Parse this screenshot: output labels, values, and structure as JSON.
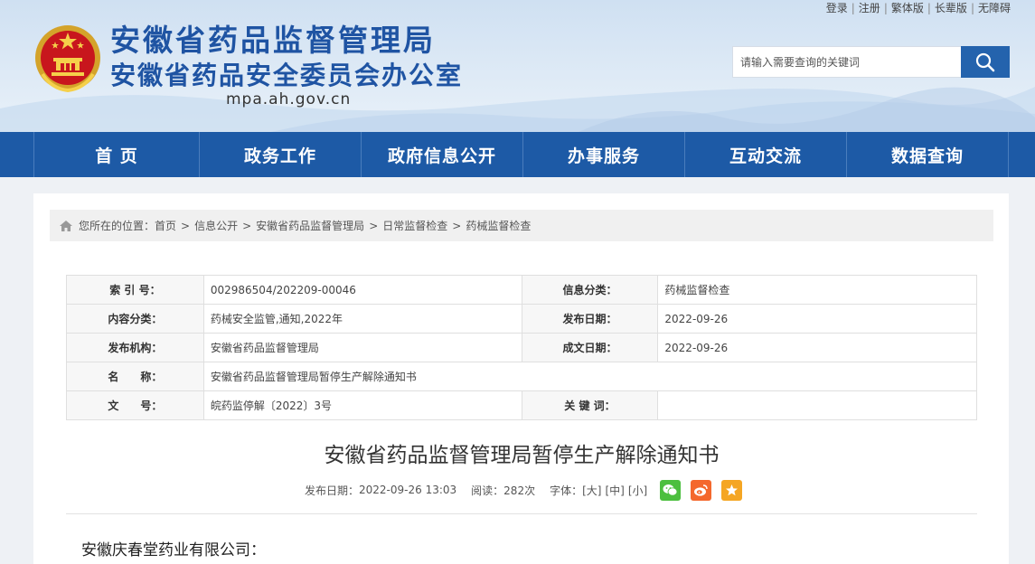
{
  "header": {
    "title_line1": "安徽省药品监督管理局",
    "title_line2": "安徽省药品安全委员会办公室",
    "domain": "mpa.ah.gov.cn",
    "top_links": [
      "登录",
      "注册",
      "繁体版",
      "长辈版",
      "无障碍"
    ],
    "search": {
      "placeholder": "请输入需要查询的关键词",
      "icon": "search-icon"
    }
  },
  "nav": {
    "items": [
      "首 页",
      "政务工作",
      "政府信息公开",
      "办事服务",
      "互动交流",
      "数据查询"
    ]
  },
  "breadcrumb": {
    "prefix": "您所在的位置：",
    "items": [
      "首页",
      "信息公开",
      "安徽省药品监督管理局",
      "日常监督检查",
      "药械监督检查"
    ],
    "separator": ">"
  },
  "meta_table": {
    "index_label": "索 引 号：",
    "index_value": "002986504/202209-00046",
    "category_label": "信息分类：",
    "category_value": "药械监督检查",
    "content_type_label": "内容分类：",
    "content_type_value": "药械安全监管,通知,2022年",
    "publish_date_label": "发布日期：",
    "publish_date_value": "2022-09-26",
    "publisher_label": "发布机构：",
    "publisher_value": "安徽省药品监督管理局",
    "created_date_label": "成文日期：",
    "created_date_value": "2022-09-26",
    "name_label": "名　　称：",
    "name_value": "安徽省药品监督管理局暂停生产解除通知书",
    "doc_no_label": "文　　号：",
    "doc_no_value": "皖药监停解〔2022〕3号",
    "keywords_label": "关 键 词：",
    "keywords_value": ""
  },
  "article": {
    "title": "安徽省药品监督管理局暂停生产解除通知书",
    "publish_label": "发布日期：",
    "publish_value": "2022-09-26 13:03",
    "read_label": "阅读：",
    "read_value": "282次",
    "font_label": "字体：",
    "font_large": "[大]",
    "font_medium": "[中]",
    "font_small": "[小]",
    "share_icons": [
      "wechat-icon",
      "weibo-icon",
      "favorite-icon"
    ],
    "body_first_line": "安徽庆春堂药业有限公司："
  },
  "colors": {
    "brand_blue": "#1f54a3",
    "nav_blue": "#1d5aa6",
    "wechat": "#4cbf3e",
    "weibo": "#f4682d",
    "favorite": "#f5a623"
  }
}
